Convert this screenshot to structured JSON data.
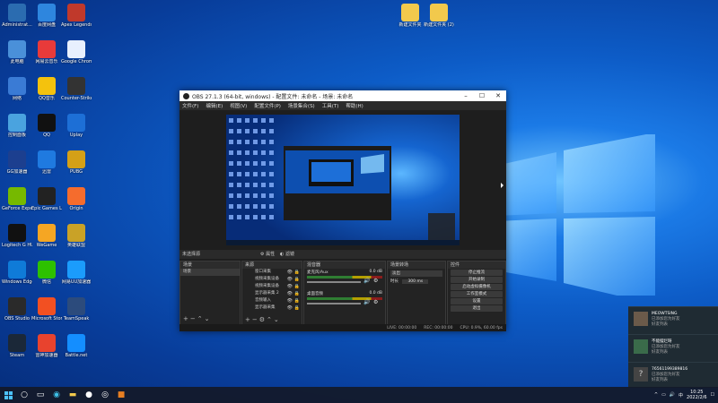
{
  "desktop": {
    "top_folders": [
      {
        "label": "新建文件夹",
        "icon": "folder-icon"
      },
      {
        "label": "新建文件夹 (2)",
        "icon": "folder-icon"
      }
    ],
    "icons": [
      {
        "label": "Administrat...",
        "color": "#2b6cb0",
        "icon": "user-folder-icon"
      },
      {
        "label": "此电脑",
        "color": "#4a90d9",
        "icon": "computer-icon"
      },
      {
        "label": "网络",
        "color": "#3a7bd5",
        "icon": "network-icon"
      },
      {
        "label": "控制面板",
        "color": "#4aa3df",
        "icon": "control-panel-icon"
      },
      {
        "label": "GG加速器",
        "color": "#1c3f8f",
        "icon": "gg-icon"
      },
      {
        "label": "GeForce Experience",
        "color": "#76b900",
        "icon": "geforce-icon"
      },
      {
        "label": "Logitech G HUB",
        "color": "#111111",
        "icon": "logitech-icon"
      },
      {
        "label": "Windows Edge",
        "color": "#0f7bd8",
        "icon": "edge-icon"
      },
      {
        "label": "OBS Studio",
        "color": "#2a2a2a",
        "icon": "obs-icon"
      },
      {
        "label": "Steam",
        "color": "#1b2838",
        "icon": "steam-icon"
      },
      {
        "label": "百度网盘",
        "color": "#2e86de",
        "icon": "baidu-icon"
      },
      {
        "label": "网易云音乐",
        "color": "#e83a3a",
        "icon": "netease-icon"
      },
      {
        "label": "QQ音乐",
        "color": "#f4c20d",
        "icon": "qq-music-icon"
      },
      {
        "label": "QQ",
        "color": "#111111",
        "icon": "qq-icon"
      },
      {
        "label": "迅雷",
        "color": "#1f7ae0",
        "icon": "xunlei-icon"
      },
      {
        "label": "Epic Games Launcher",
        "color": "#222222",
        "icon": "epic-icon"
      },
      {
        "label": "WeGame",
        "color": "#f5a623",
        "icon": "wegame-icon"
      },
      {
        "label": "微信",
        "color": "#2dc100",
        "icon": "wechat-icon"
      },
      {
        "label": "Microsoft Store",
        "color": "#f25022",
        "icon": "store-icon"
      },
      {
        "label": "雷神加速器",
        "color": "#e8432e",
        "icon": "leishen-icon"
      },
      {
        "label": "Apex Legends",
        "color": "#c0392b",
        "icon": "apex-icon"
      },
      {
        "label": "Google Chrome",
        "color": "#e8f0fe",
        "icon": "chrome-icon"
      },
      {
        "label": "Counter-Strike",
        "color": "#333333",
        "icon": "csgo-icon"
      },
      {
        "label": "Uplay",
        "color": "#1d6fd6",
        "icon": "uplay-icon"
      },
      {
        "label": "PUBG",
        "color": "#d4a017",
        "icon": "pubg-icon"
      },
      {
        "label": "Origin",
        "color": "#f56c2d",
        "icon": "origin-icon"
      },
      {
        "label": "英雄联盟",
        "color": "#c9a227",
        "icon": "lol-icon"
      },
      {
        "label": "网易UU加速器",
        "color": "#1b9cfc",
        "icon": "uu-icon"
      },
      {
        "label": "TeamSpeak",
        "color": "#2c4b7c",
        "icon": "teamspeak-icon"
      },
      {
        "label": "Battle.net",
        "color": "#148eff",
        "icon": "battlenet-icon"
      }
    ]
  },
  "obs": {
    "title": "OBS 27.1.3 (64-bit, windows) - 配置文件: 未命名 - 场景: 未命名",
    "menu": [
      "文件(F)",
      "编辑(E)",
      "视图(V)",
      "配置文件(P)",
      "场景集合(S)",
      "工具(T)",
      "帮助(H)"
    ],
    "toolbar_left": "未选择源",
    "toolbar_props": "属性",
    "toolbar_filters": "滤镜",
    "docks": {
      "scenes": {
        "title": "场景",
        "items": [
          "场景"
        ]
      },
      "sources": {
        "title": "来源",
        "items": [
          "窗口采集",
          "视频采集设备",
          "视频采集设备",
          "显示器采集 2",
          "音频输入",
          "显示器采集"
        ]
      },
      "mixer": {
        "title": "混音器",
        "channels": [
          {
            "name": "麦克风/Aux",
            "db": "0.0 dB"
          },
          {
            "name": "桌面音频",
            "db": "0.0 dB"
          }
        ]
      },
      "transitions": {
        "title": "场景转场",
        "type": "淡出",
        "duration_label": "时长",
        "duration_value": "300 ms"
      },
      "controls": {
        "title": "控件",
        "buttons": [
          "停止推流",
          "开始录制",
          "启动虚拟摄像机",
          "工作室模式",
          "设置",
          "退出"
        ]
      }
    },
    "status": {
      "live": "LIVE: 00:00:00",
      "rec": "REC: 00:00:00",
      "cpu": "CPU: 0.9%, 60.00 fps"
    }
  },
  "notifications": [
    {
      "name": "MEOWTSING",
      "line1": "已添加您为好友",
      "line2": "好友列表"
    },
    {
      "name": "不能摆烂呀",
      "line1": "已添加您为好友",
      "line2": "好友列表"
    },
    {
      "name": "76561199389816",
      "line1": "已添加您为好友",
      "line2": "好友列表"
    }
  ],
  "taskbar": {
    "time": "10:25",
    "date": "2022/2/6"
  }
}
